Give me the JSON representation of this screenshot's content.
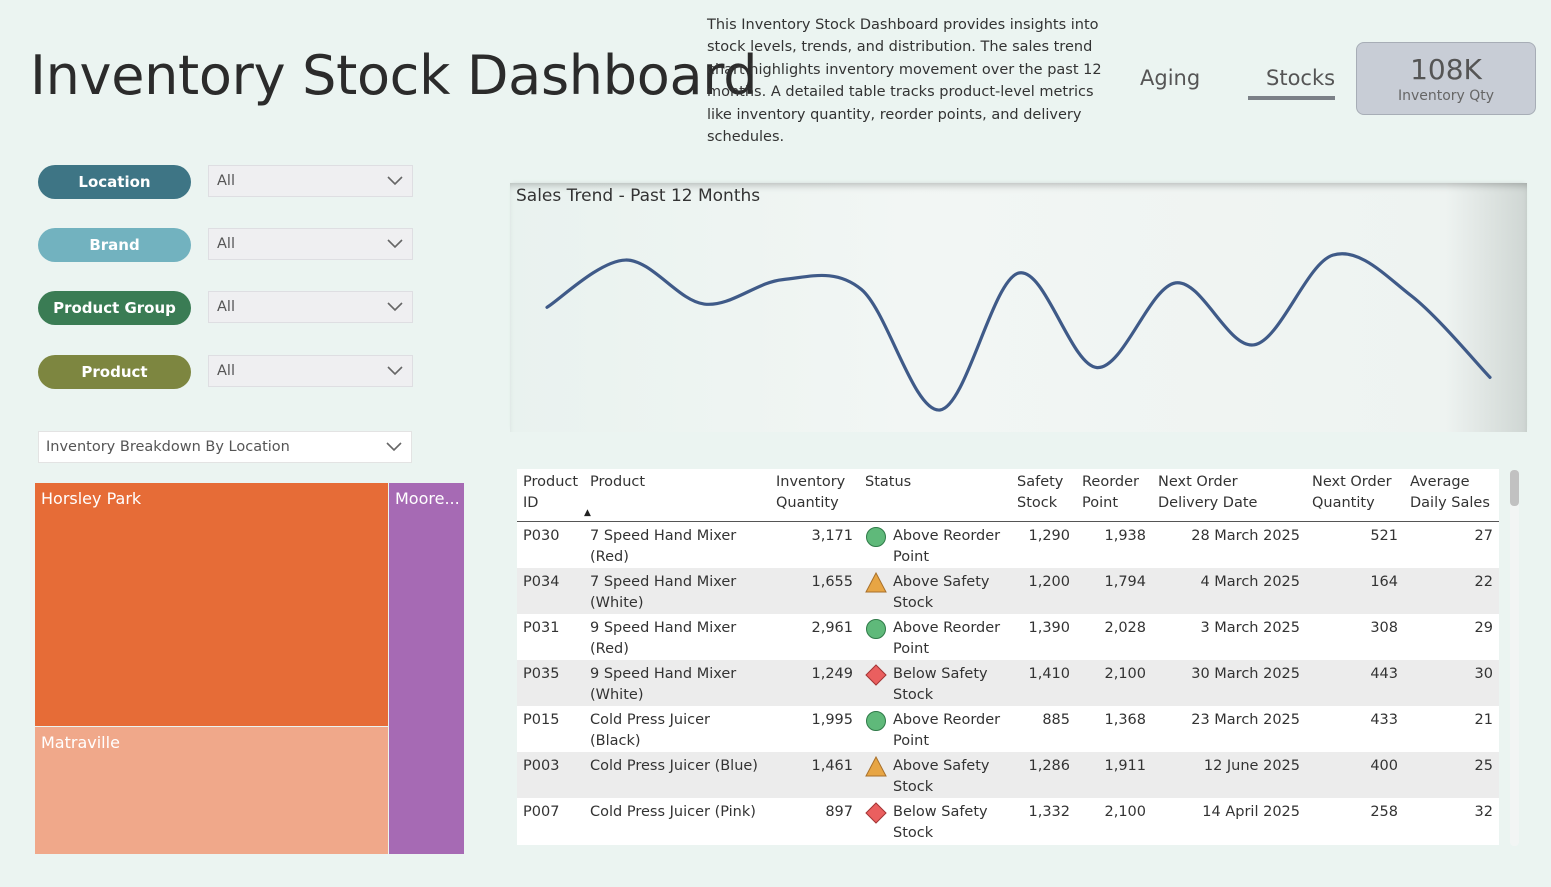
{
  "header": {
    "title": "Inventory Stock Dashboard",
    "description": "This Inventory Stock Dashboard provides insights into stock levels, trends, and distribution. The sales trend chart highlights inventory movement over the past 12 months. A detailed table tracks product-level metrics like inventory quantity, reorder points, and delivery schedules.",
    "tabs": [
      {
        "label": "Aging"
      },
      {
        "label": "Stocks"
      }
    ],
    "active_tab": "Stocks"
  },
  "kpi": {
    "value": "108K",
    "label": "Inventory Qty",
    "background": "#c8cdd6"
  },
  "slicers": [
    {
      "label": "Location",
      "value": "All",
      "color": "#3e7585"
    },
    {
      "label": "Brand",
      "value": "All",
      "color": "#72b2bf"
    },
    {
      "label": "Product Group",
      "value": "All",
      "color": "#3a7c54"
    },
    {
      "label": "Product",
      "value": "All",
      "color": "#7d8640"
    }
  ],
  "breakdown": {
    "selector_value": "Inventory Breakdown By Location",
    "treemap": [
      {
        "label": "Horsley Park",
        "color": "#e66c37"
      },
      {
        "label": "Matraville",
        "color": "#f0a88a"
      },
      {
        "label": "Moore...",
        "color": "#a66ab4"
      }
    ]
  },
  "chart_data": {
    "type": "line",
    "title": "Sales Trend - Past 12 Months",
    "x": [
      1,
      2,
      3,
      4,
      5,
      6,
      7,
      8,
      9,
      10,
      11,
      12,
      13
    ],
    "series": [
      {
        "values": [
          0.63,
          0.92,
          0.65,
          0.8,
          0.74,
          0.0,
          0.84,
          0.26,
          0.78,
          0.4,
          0.95,
          0.7,
          0.2
        ],
        "color": "#3f5a88"
      }
    ],
    "axes_visible": false,
    "grid": false
  },
  "table": {
    "columns": [
      "Product ID",
      "Product",
      "Inventory Quantity",
      "Status",
      "Safety Stock",
      "Reorder Point",
      "Next Order Delivery Date",
      "Next Order Quantity",
      "Average Daily Sales"
    ],
    "sort_indicator": "▲",
    "rows": [
      {
        "id": "P030",
        "product": "7 Speed Hand Mixer (Red)",
        "qty": "3,171",
        "status_icon": "green-circle-icon",
        "status": "Above Reorder Point",
        "safety": "1,290",
        "reorder": "1,938",
        "date": "28 March 2025",
        "next_qty": "521",
        "avg": "27"
      },
      {
        "id": "P034",
        "product": "7 Speed Hand Mixer (White)",
        "qty": "1,655",
        "status_icon": "amber-triangle-icon",
        "status": "Above Safety Stock",
        "safety": "1,200",
        "reorder": "1,794",
        "date": "4 March 2025",
        "next_qty": "164",
        "avg": "22"
      },
      {
        "id": "P031",
        "product": "9 Speed Hand Mixer (Red)",
        "qty": "2,961",
        "status_icon": "green-circle-icon",
        "status": "Above Reorder Point",
        "safety": "1,390",
        "reorder": "2,028",
        "date": "3 March 2025",
        "next_qty": "308",
        "avg": "29"
      },
      {
        "id": "P035",
        "product": "9 Speed Hand Mixer (White)",
        "qty": "1,249",
        "status_icon": "red-diamond-icon",
        "status": "Below Safety Stock",
        "safety": "1,410",
        "reorder": "2,100",
        "date": "30 March 2025",
        "next_qty": "443",
        "avg": "30"
      },
      {
        "id": "P015",
        "product": "Cold Press Juicer (Black)",
        "qty": "1,995",
        "status_icon": "green-circle-icon",
        "status": "Above Reorder Point",
        "safety": "885",
        "reorder": "1,368",
        "date": "23 March 2025",
        "next_qty": "433",
        "avg": "21"
      },
      {
        "id": "P003",
        "product": "Cold Press Juicer (Blue)",
        "qty": "1,461",
        "status_icon": "amber-triangle-icon",
        "status": "Above Safety Stock",
        "safety": "1,286",
        "reorder": "1,911",
        "date": "12 June 2025",
        "next_qty": "400",
        "avg": "25"
      },
      {
        "id": "P007",
        "product": "Cold Press Juicer (Pink)",
        "qty": "897",
        "status_icon": "red-diamond-icon",
        "status": "Below Safety Stock",
        "safety": "1,332",
        "reorder": "2,100",
        "date": "14 April 2025",
        "next_qty": "258",
        "avg": "32"
      }
    ]
  }
}
